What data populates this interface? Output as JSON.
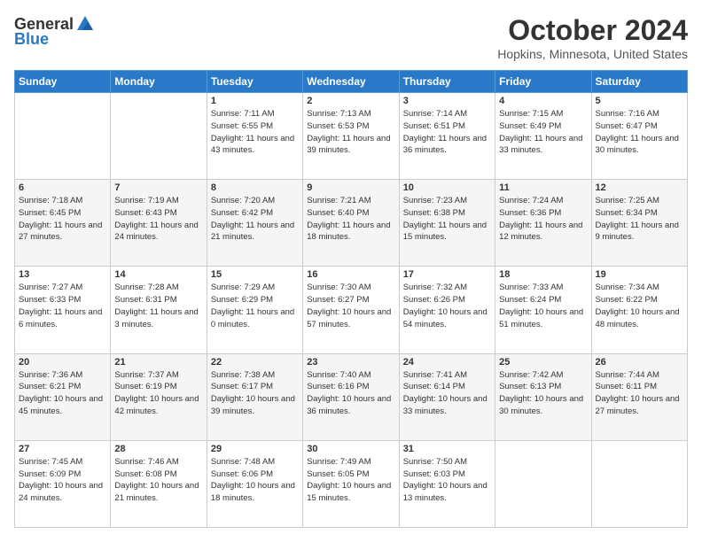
{
  "header": {
    "logo_general": "General",
    "logo_blue": "Blue",
    "month_title": "October 2024",
    "location": "Hopkins, Minnesota, United States"
  },
  "weekdays": [
    "Sunday",
    "Monday",
    "Tuesday",
    "Wednesday",
    "Thursday",
    "Friday",
    "Saturday"
  ],
  "weeks": [
    [
      {
        "day": "",
        "sunrise": "",
        "sunset": "",
        "daylight": ""
      },
      {
        "day": "",
        "sunrise": "",
        "sunset": "",
        "daylight": ""
      },
      {
        "day": "1",
        "sunrise": "Sunrise: 7:11 AM",
        "sunset": "Sunset: 6:55 PM",
        "daylight": "Daylight: 11 hours and 43 minutes."
      },
      {
        "day": "2",
        "sunrise": "Sunrise: 7:13 AM",
        "sunset": "Sunset: 6:53 PM",
        "daylight": "Daylight: 11 hours and 39 minutes."
      },
      {
        "day": "3",
        "sunrise": "Sunrise: 7:14 AM",
        "sunset": "Sunset: 6:51 PM",
        "daylight": "Daylight: 11 hours and 36 minutes."
      },
      {
        "day": "4",
        "sunrise": "Sunrise: 7:15 AM",
        "sunset": "Sunset: 6:49 PM",
        "daylight": "Daylight: 11 hours and 33 minutes."
      },
      {
        "day": "5",
        "sunrise": "Sunrise: 7:16 AM",
        "sunset": "Sunset: 6:47 PM",
        "daylight": "Daylight: 11 hours and 30 minutes."
      }
    ],
    [
      {
        "day": "6",
        "sunrise": "Sunrise: 7:18 AM",
        "sunset": "Sunset: 6:45 PM",
        "daylight": "Daylight: 11 hours and 27 minutes."
      },
      {
        "day": "7",
        "sunrise": "Sunrise: 7:19 AM",
        "sunset": "Sunset: 6:43 PM",
        "daylight": "Daylight: 11 hours and 24 minutes."
      },
      {
        "day": "8",
        "sunrise": "Sunrise: 7:20 AM",
        "sunset": "Sunset: 6:42 PM",
        "daylight": "Daylight: 11 hours and 21 minutes."
      },
      {
        "day": "9",
        "sunrise": "Sunrise: 7:21 AM",
        "sunset": "Sunset: 6:40 PM",
        "daylight": "Daylight: 11 hours and 18 minutes."
      },
      {
        "day": "10",
        "sunrise": "Sunrise: 7:23 AM",
        "sunset": "Sunset: 6:38 PM",
        "daylight": "Daylight: 11 hours and 15 minutes."
      },
      {
        "day": "11",
        "sunrise": "Sunrise: 7:24 AM",
        "sunset": "Sunset: 6:36 PM",
        "daylight": "Daylight: 11 hours and 12 minutes."
      },
      {
        "day": "12",
        "sunrise": "Sunrise: 7:25 AM",
        "sunset": "Sunset: 6:34 PM",
        "daylight": "Daylight: 11 hours and 9 minutes."
      }
    ],
    [
      {
        "day": "13",
        "sunrise": "Sunrise: 7:27 AM",
        "sunset": "Sunset: 6:33 PM",
        "daylight": "Daylight: 11 hours and 6 minutes."
      },
      {
        "day": "14",
        "sunrise": "Sunrise: 7:28 AM",
        "sunset": "Sunset: 6:31 PM",
        "daylight": "Daylight: 11 hours and 3 minutes."
      },
      {
        "day": "15",
        "sunrise": "Sunrise: 7:29 AM",
        "sunset": "Sunset: 6:29 PM",
        "daylight": "Daylight: 11 hours and 0 minutes."
      },
      {
        "day": "16",
        "sunrise": "Sunrise: 7:30 AM",
        "sunset": "Sunset: 6:27 PM",
        "daylight": "Daylight: 10 hours and 57 minutes."
      },
      {
        "day": "17",
        "sunrise": "Sunrise: 7:32 AM",
        "sunset": "Sunset: 6:26 PM",
        "daylight": "Daylight: 10 hours and 54 minutes."
      },
      {
        "day": "18",
        "sunrise": "Sunrise: 7:33 AM",
        "sunset": "Sunset: 6:24 PM",
        "daylight": "Daylight: 10 hours and 51 minutes."
      },
      {
        "day": "19",
        "sunrise": "Sunrise: 7:34 AM",
        "sunset": "Sunset: 6:22 PM",
        "daylight": "Daylight: 10 hours and 48 minutes."
      }
    ],
    [
      {
        "day": "20",
        "sunrise": "Sunrise: 7:36 AM",
        "sunset": "Sunset: 6:21 PM",
        "daylight": "Daylight: 10 hours and 45 minutes."
      },
      {
        "day": "21",
        "sunrise": "Sunrise: 7:37 AM",
        "sunset": "Sunset: 6:19 PM",
        "daylight": "Daylight: 10 hours and 42 minutes."
      },
      {
        "day": "22",
        "sunrise": "Sunrise: 7:38 AM",
        "sunset": "Sunset: 6:17 PM",
        "daylight": "Daylight: 10 hours and 39 minutes."
      },
      {
        "day": "23",
        "sunrise": "Sunrise: 7:40 AM",
        "sunset": "Sunset: 6:16 PM",
        "daylight": "Daylight: 10 hours and 36 minutes."
      },
      {
        "day": "24",
        "sunrise": "Sunrise: 7:41 AM",
        "sunset": "Sunset: 6:14 PM",
        "daylight": "Daylight: 10 hours and 33 minutes."
      },
      {
        "day": "25",
        "sunrise": "Sunrise: 7:42 AM",
        "sunset": "Sunset: 6:13 PM",
        "daylight": "Daylight: 10 hours and 30 minutes."
      },
      {
        "day": "26",
        "sunrise": "Sunrise: 7:44 AM",
        "sunset": "Sunset: 6:11 PM",
        "daylight": "Daylight: 10 hours and 27 minutes."
      }
    ],
    [
      {
        "day": "27",
        "sunrise": "Sunrise: 7:45 AM",
        "sunset": "Sunset: 6:09 PM",
        "daylight": "Daylight: 10 hours and 24 minutes."
      },
      {
        "day": "28",
        "sunrise": "Sunrise: 7:46 AM",
        "sunset": "Sunset: 6:08 PM",
        "daylight": "Daylight: 10 hours and 21 minutes."
      },
      {
        "day": "29",
        "sunrise": "Sunrise: 7:48 AM",
        "sunset": "Sunset: 6:06 PM",
        "daylight": "Daylight: 10 hours and 18 minutes."
      },
      {
        "day": "30",
        "sunrise": "Sunrise: 7:49 AM",
        "sunset": "Sunset: 6:05 PM",
        "daylight": "Daylight: 10 hours and 15 minutes."
      },
      {
        "day": "31",
        "sunrise": "Sunrise: 7:50 AM",
        "sunset": "Sunset: 6:03 PM",
        "daylight": "Daylight: 10 hours and 13 minutes."
      },
      {
        "day": "",
        "sunrise": "",
        "sunset": "",
        "daylight": ""
      },
      {
        "day": "",
        "sunrise": "",
        "sunset": "",
        "daylight": ""
      }
    ]
  ]
}
